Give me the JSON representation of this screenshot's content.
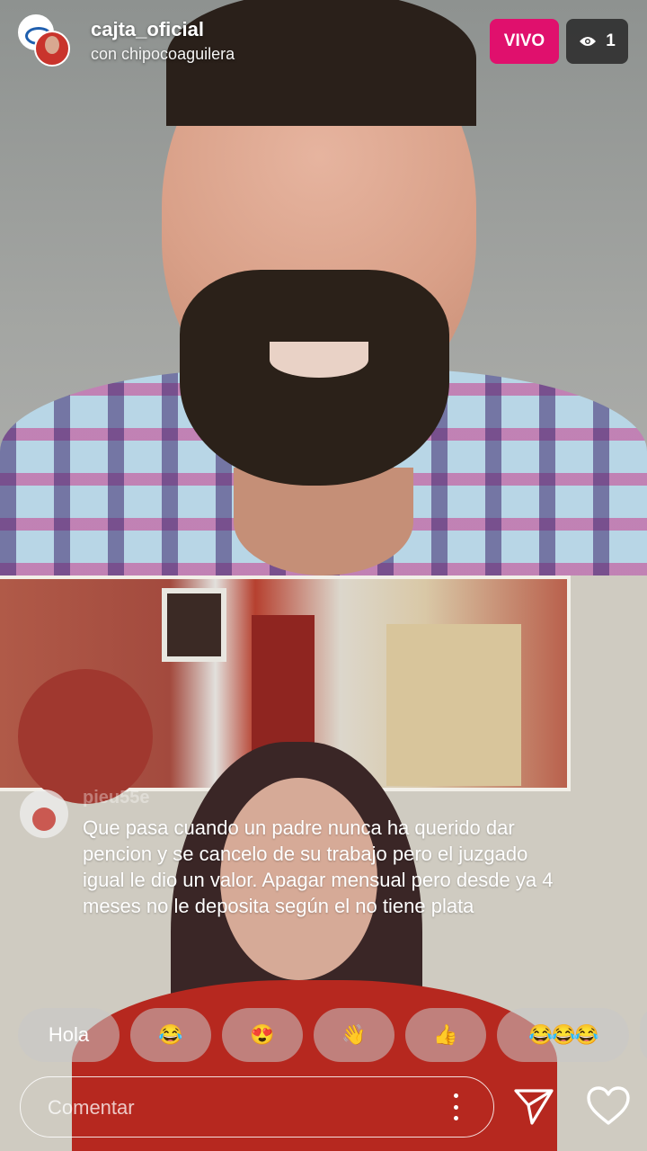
{
  "header": {
    "username": "cajta_oficial",
    "subtitle": "con chipocoaguilera",
    "live_label": "VIVO",
    "viewer_count": "1"
  },
  "comment": {
    "username": "pieu55e",
    "text": "Que pasa cuando un padre nunca ha querido dar pencion y se cancelo de su trabajo pero el juzgado igual le dio un valor. Apagar mensual pero desde ya 4 meses no le deposita según el no tiene plata"
  },
  "reactions": [
    {
      "label": "Hola"
    },
    {
      "label": "😂"
    },
    {
      "label": "😍"
    },
    {
      "label": "👋"
    },
    {
      "label": "👍"
    },
    {
      "label": "😂😂😂"
    }
  ],
  "composer": {
    "placeholder": "Comentar"
  },
  "icons": {
    "viewer": "eye-icon",
    "more": "more-vertical-icon",
    "send": "send-icon",
    "like": "heart-icon"
  },
  "colors": {
    "live_badge": "#e0106d",
    "viewer_badge": "#282828"
  }
}
